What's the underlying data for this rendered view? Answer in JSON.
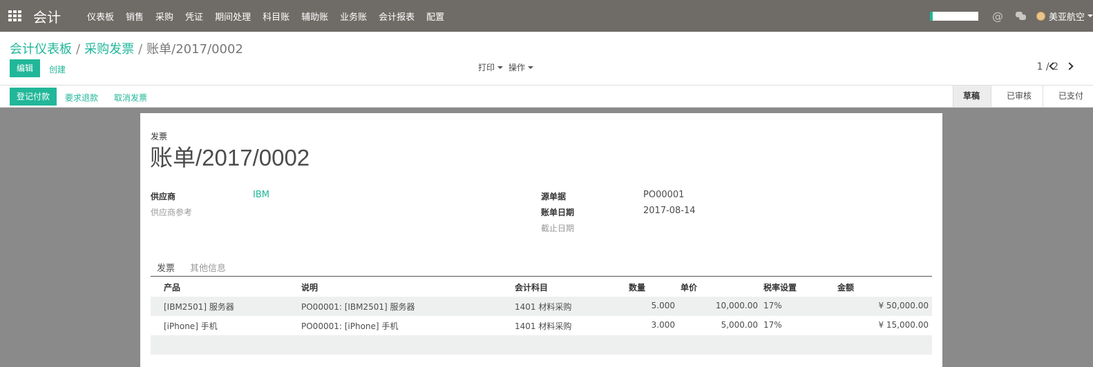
{
  "navbar": {
    "app_title": "会计",
    "menu": [
      "仪表板",
      "销售",
      "采购",
      "凭证",
      "期间处理",
      "科目账",
      "辅助账",
      "业务账",
      "会计报表",
      "配置"
    ],
    "at_symbol": "@",
    "user_name": "美亚航空"
  },
  "breadcrumb": {
    "items": [
      "会计仪表板",
      "采购发票"
    ],
    "separator": "/",
    "current": "账单/2017/0002"
  },
  "control": {
    "edit_label": "编辑",
    "create_label": "创建",
    "print_label": "打印",
    "action_label": "操作",
    "pager": "1 / 2"
  },
  "statusbar": {
    "register_payment": "登记付款",
    "request_refund": "要求退款",
    "cancel_invoice": "取消发票",
    "stages": [
      "草稿",
      "已审核",
      "已支付"
    ],
    "active_stage": "草稿"
  },
  "document": {
    "type_label": "发票",
    "title": "账单/2017/0002",
    "vendor_label": "供应商",
    "vendor_value": "IBM",
    "vendor_ref_label": "供应商参考",
    "source_label": "源单据",
    "source_value": "PO00001",
    "bill_date_label": "账单日期",
    "bill_date_value": "2017-08-14",
    "due_date_label": "截止日期"
  },
  "tabs": [
    "发票",
    "其他信息"
  ],
  "lines": {
    "headers": [
      "产品",
      "说明",
      "会计科目",
      "数量",
      "单价",
      "税率设置",
      "金额"
    ],
    "rows": [
      [
        "[IBM2501] 服务器",
        "PO00001: [IBM2501] 服务器",
        "1401 材料采购",
        "5.000",
        "10,000.00",
        "17%",
        "¥ 50,000.00"
      ],
      [
        "[iPhone] 手机",
        "PO00001: [iPhone] 手机",
        "1401 材料采购",
        "3.000",
        "5,000.00",
        "17%",
        "¥ 15,000.00"
      ]
    ]
  },
  "colors": {
    "accent": "#21b799",
    "navbar": "#6f6b66"
  }
}
